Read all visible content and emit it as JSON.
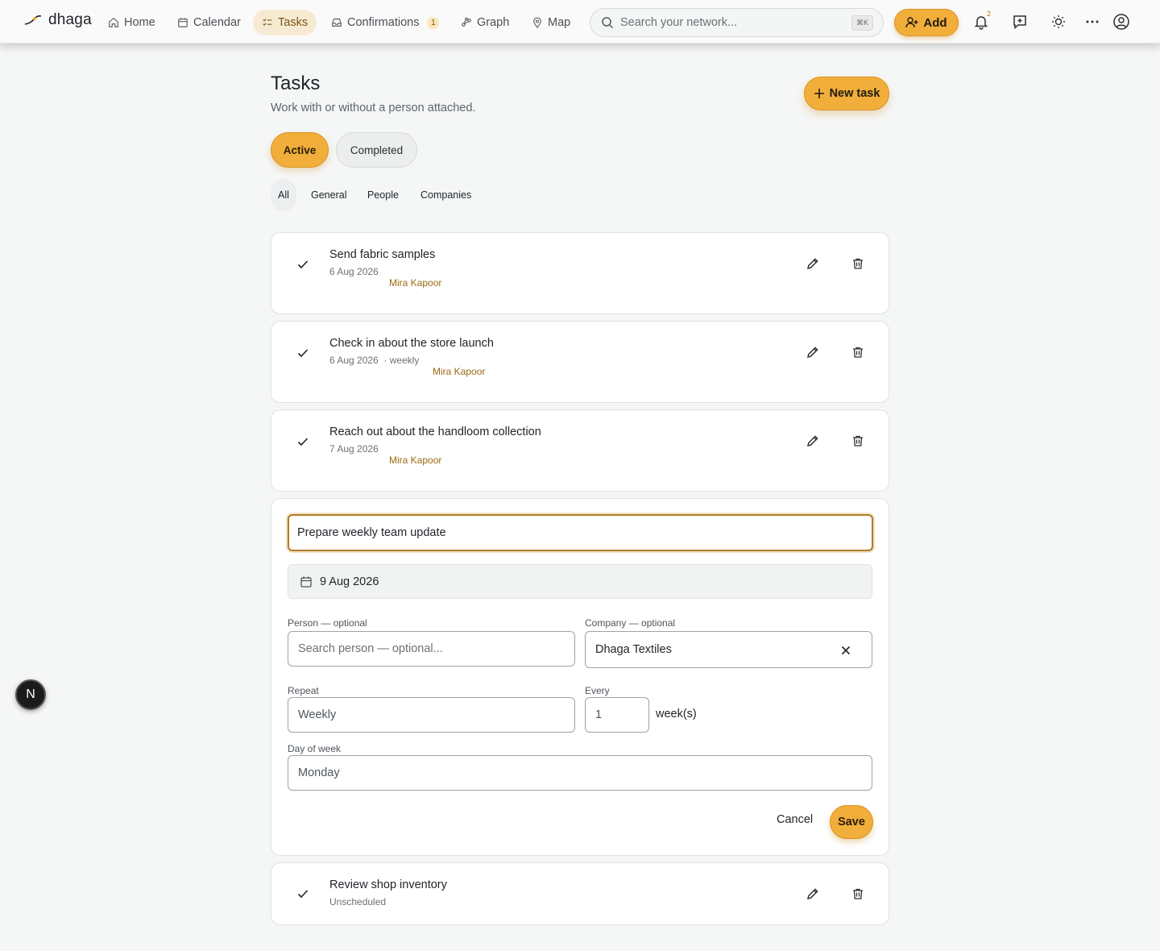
{
  "nav": {
    "brand": "dhaga",
    "items": [
      {
        "label": "Home",
        "icon": "home-icon"
      },
      {
        "label": "Calendar",
        "icon": "calendar-icon"
      },
      {
        "label": "Tasks",
        "icon": "tasks-icon",
        "active": true
      },
      {
        "label": "Confirmations",
        "icon": "inbox-icon",
        "count": "1"
      },
      {
        "label": "Graph",
        "icon": "graph-icon"
      },
      {
        "label": "Map",
        "icon": "map-pin-icon"
      }
    ],
    "search_placeholder": "Search your network...",
    "search_shortcut": "⌘K",
    "add_label": "Add",
    "notification_count": "2",
    "icons": [
      "bell-icon",
      "message-plus-icon",
      "sun-icon",
      "more-icon",
      "account-icon"
    ]
  },
  "page": {
    "title": "Tasks",
    "subtitle": "Work with or without a person attached.",
    "new_task_label": "New task",
    "status_tabs": {
      "active": "Active",
      "completed": "Completed"
    },
    "filters": [
      "All",
      "General",
      "People",
      "Companies"
    ],
    "selected_filter": "All"
  },
  "tasks": [
    {
      "title": "Send fabric samples",
      "date": "6 Aug 2026",
      "repeat": "",
      "person": "Mira Kapoor"
    },
    {
      "title": "Check in about the store launch",
      "date": "6 Aug 2026",
      "repeat": "· weekly",
      "person": "Mira Kapoor"
    },
    {
      "title": "Reach out about the handloom collection",
      "date": "7 Aug 2026",
      "repeat": "",
      "person": "Mira Kapoor"
    }
  ],
  "edit_form": {
    "title_value": "Prepare weekly team update",
    "date_value": "9 Aug 2026",
    "person_label": "Person — optional",
    "person_placeholder": "Search person — optional...",
    "company_label": "Company — optional",
    "company_value": "Dhaga Textiles",
    "repeat_label": "Repeat",
    "repeat_value": "Weekly",
    "every_label": "Every",
    "every_value": "1",
    "every_unit": "week(s)",
    "day_label": "Day of week",
    "day_value": "Monday",
    "cancel_label": "Cancel",
    "save_label": "Save"
  },
  "last_task": {
    "title": "Review shop inventory",
    "meta": "Unscheduled"
  },
  "dev_badge": "N",
  "colors": {
    "accent": "#f1ae3a",
    "accent_border": "#d99422",
    "person_link": "#9b6a12",
    "focus_border": "#b07c2a"
  }
}
